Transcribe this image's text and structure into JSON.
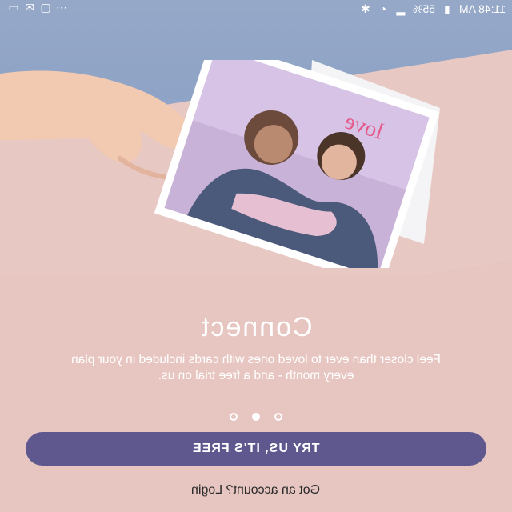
{
  "status_bar": {
    "time": "11:48 AM",
    "battery": "55%",
    "icons": [
      "battery-icon",
      "signal-icon",
      "wifi-icon",
      "bluetooth-icon",
      "more-icon",
      "sim-icon",
      "sms-icon",
      "cast-icon"
    ]
  },
  "hero": {
    "card_word": "love"
  },
  "onboarding": {
    "title": "Connect",
    "description": "Feel closer than ever to loved ones with cards included in your plan every month - and a free trial on us.",
    "page_index": 1,
    "page_count": 3
  },
  "actions": {
    "cta_label": "TRY US, IT'S FREE",
    "login_label": "Got an account? Login"
  },
  "colors": {
    "cta": "#5f588f",
    "background": "#e7c6c1",
    "sky": "#8ea3c6"
  }
}
